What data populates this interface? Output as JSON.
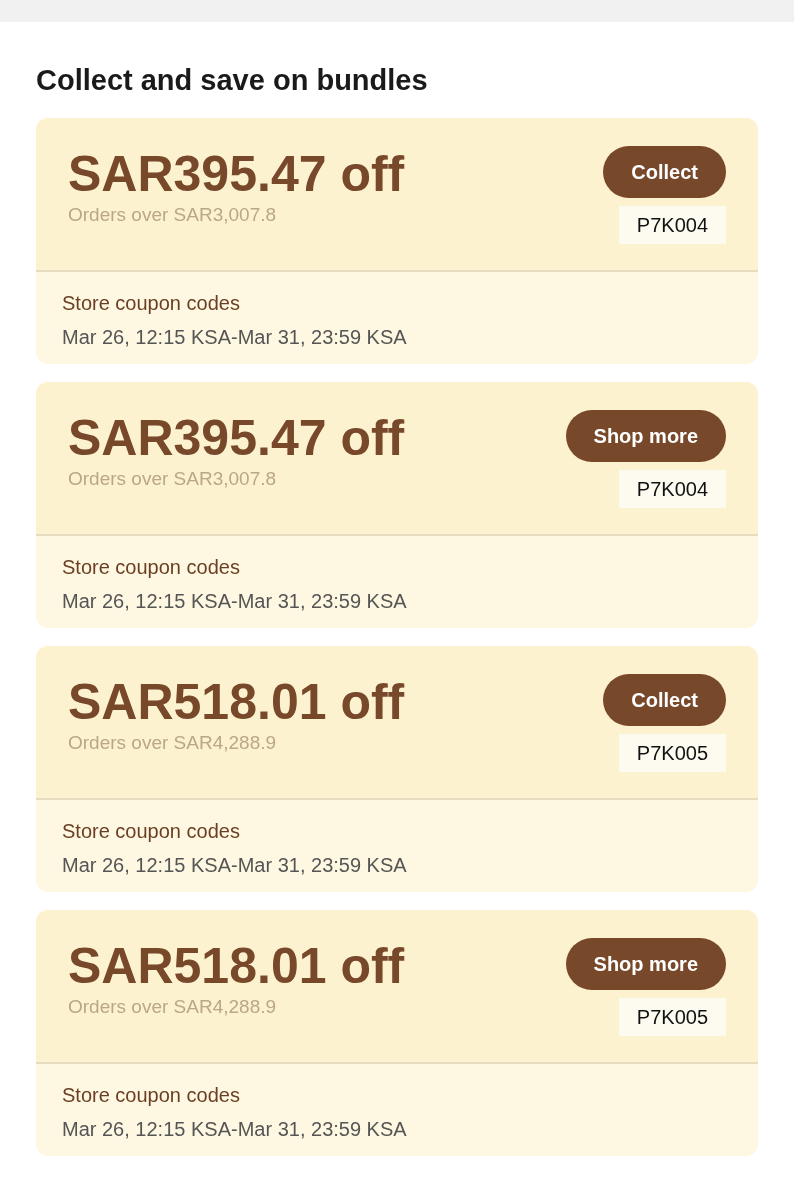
{
  "section": {
    "title": "Collect and save on bundles"
  },
  "coupons": [
    {
      "amount": "SAR395.47 off",
      "condition": "Orders over SAR3,007.8",
      "button": "Collect",
      "code": "P7K004",
      "type": "Store coupon codes",
      "validity": "Mar 26, 12:15 KSA-Mar 31, 23:59 KSA"
    },
    {
      "amount": "SAR395.47 off",
      "condition": "Orders over SAR3,007.8",
      "button": "Shop more",
      "code": "P7K004",
      "type": "Store coupon codes",
      "validity": "Mar 26, 12:15 KSA-Mar 31, 23:59 KSA"
    },
    {
      "amount": "SAR518.01 off",
      "condition": "Orders over SAR4,288.9",
      "button": "Collect",
      "code": "P7K005",
      "type": "Store coupon codes",
      "validity": "Mar 26, 12:15 KSA-Mar 31, 23:59 KSA"
    },
    {
      "amount": "SAR518.01 off",
      "condition": "Orders over SAR4,288.9",
      "button": "Shop more",
      "code": "P7K005",
      "type": "Store coupon codes",
      "validity": "Mar 26, 12:15 KSA-Mar 31, 23:59 KSA"
    }
  ]
}
